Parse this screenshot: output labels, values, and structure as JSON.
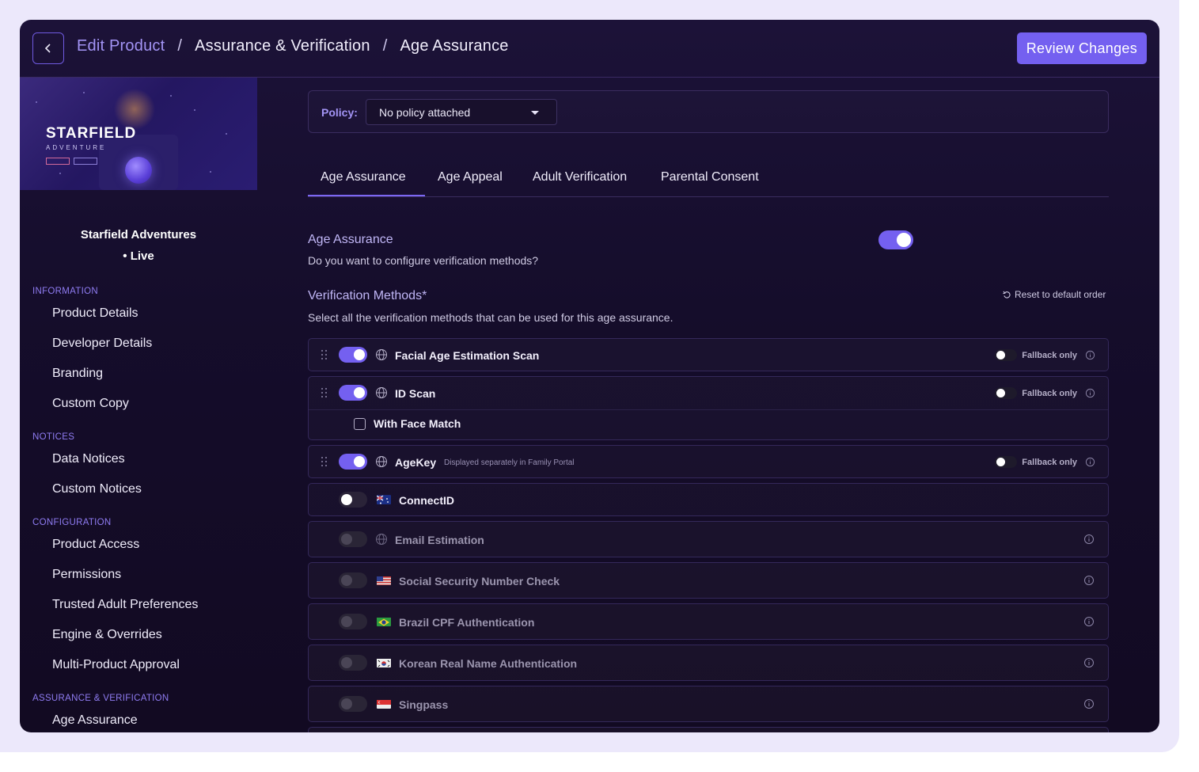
{
  "header": {
    "breadcrumb": [
      "Edit Product",
      "Assurance & Verification",
      "Age Assurance"
    ],
    "separator": "/",
    "review_button": "Review Changes"
  },
  "sidebar": {
    "banner": {
      "title": "STARFIELD",
      "subtitle": "ADVENTURE"
    },
    "product_name": "Starfield Adventures",
    "product_status": "• Live",
    "sections": [
      {
        "title": "INFORMATION",
        "items": [
          "Product Details",
          "Developer Details",
          "Branding",
          "Custom Copy"
        ]
      },
      {
        "title": "NOTICES",
        "items": [
          "Data Notices",
          "Custom Notices"
        ]
      },
      {
        "title": "CONFIGURATION",
        "items": [
          "Product Access",
          "Permissions",
          "Trusted Adult Preferences",
          "Engine & Overrides",
          "Multi-Product Approval"
        ]
      },
      {
        "title": "ASSURANCE & VERIFICATION",
        "items": [
          "Age Assurance"
        ]
      }
    ]
  },
  "policy": {
    "label": "Policy:",
    "value": "No policy attached"
  },
  "tabs": [
    "Age Assurance",
    "Age Appeal",
    "Adult Verification",
    "Parental Consent"
  ],
  "active_tab": "Age Assurance",
  "age_assurance": {
    "title": "Age Assurance",
    "question": "Do you want to configure verification methods?",
    "enabled": true
  },
  "verification": {
    "title": "Verification Methods*",
    "subtitle": "Select all the verification methods that can be used for this age assurance.",
    "reset_label": "Reset to default order",
    "fallback_label": "Fallback only",
    "methods": [
      {
        "label": "Facial Age Estimation Scan",
        "state": "on",
        "icon": "globe-icon",
        "fallback": true
      },
      {
        "label": "ID Scan",
        "state": "on",
        "icon": "globe-icon",
        "fallback": true,
        "sub_option": "With Face Match"
      },
      {
        "label": "AgeKey",
        "state": "on",
        "icon": "globe-icon",
        "fallback": true,
        "note": "Displayed separately in Family Portal"
      },
      {
        "label": "ConnectID",
        "state": "off",
        "icon": "australia-flag-icon"
      },
      {
        "label": "Email Estimation",
        "state": "disabled",
        "icon": "globe-icon"
      },
      {
        "label": "Social Security Number Check",
        "state": "disabled",
        "icon": "us-flag-icon"
      },
      {
        "label": "Brazil CPF Authentication",
        "state": "disabled",
        "icon": "brazil-flag-icon"
      },
      {
        "label": "Korean Real Name Authentication",
        "state": "disabled",
        "icon": "korea-flag-icon"
      },
      {
        "label": "Singpass",
        "state": "disabled",
        "icon": "singapore-flag-icon"
      }
    ]
  },
  "colors": {
    "accent": "#7460f0",
    "background": "#160d2c",
    "accent_text": "#a394f5"
  }
}
